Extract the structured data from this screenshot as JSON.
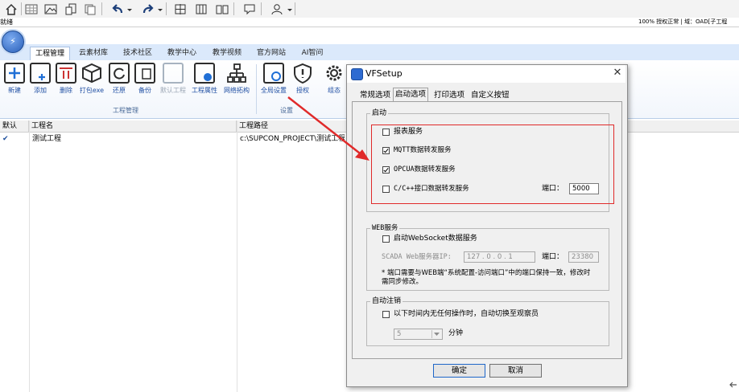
{
  "status": {
    "left": "就绪",
    "right": "100% 授权正常 | 域：OAD[子工程"
  },
  "app_button": {
    "glyph": "⚡"
  },
  "tabs": [
    "工程管理",
    "云素材库",
    "技术社区",
    "教学中心",
    "教学视频",
    "官方网站",
    "AI智问"
  ],
  "ribbon": {
    "buttons": [
      "新建",
      "添加",
      "删除",
      "打包exe",
      "还原",
      "备份",
      "默认工程",
      "工程属性",
      "网络拓构",
      "全局设置",
      "授权",
      "组态"
    ],
    "groups": [
      "工程管理",
      "设置"
    ]
  },
  "table": {
    "headers": [
      "默认",
      "工程名",
      "工程路径"
    ],
    "rows": [
      {
        "check": "✔",
        "name": "测试工程",
        "path": "c:\\SUPCON_PROJECT\\测试工程"
      }
    ]
  },
  "dialog": {
    "title": "VFSetup",
    "close": "✕",
    "tabs": [
      "常规选项",
      "启动选项",
      "打印选项",
      "自定义按钮"
    ],
    "startup": {
      "legend": "启动",
      "report_service": "报表服务",
      "mqtt_service": "MQTT数据转发服务",
      "opcua_service": "OPCUA数据转发服务",
      "cpp_service": "C/C++接口数据转发服务",
      "port_label": "端口：",
      "port_value": "5000"
    },
    "web": {
      "legend": "WEB服务",
      "websocket": "启动WebSocket数据服务",
      "scada_label": "SCADA Web服务器IP:",
      "ip_value": "127 . 0 . 0 . 1",
      "port_label": "端口：",
      "port_value": "23380",
      "note": "* 端口需要与WEB端“系统配置-访问端口”中的端口保持一致，修改时需同步修改。"
    },
    "auto_logout": {
      "legend": "自动注销",
      "option": "以下时间内无任何操作时，自动切换至观察员",
      "minutes_value": "5",
      "minutes_unit": "分钟"
    },
    "ok": "确定",
    "cancel": "取消"
  }
}
